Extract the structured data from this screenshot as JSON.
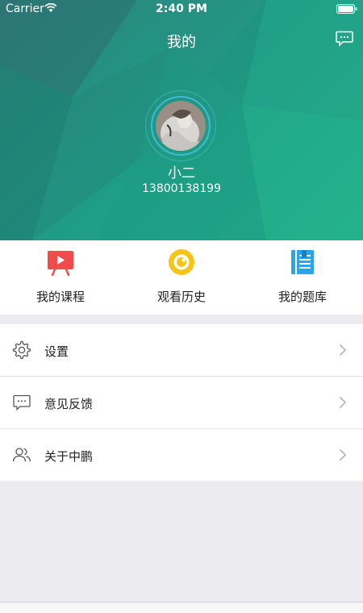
{
  "status_bar": {
    "carrier": "Carrier",
    "time": "2:40 PM"
  },
  "header": {
    "title": "我的",
    "accent_color": "#22b48c"
  },
  "profile": {
    "name": "小二",
    "phone": "13800138199"
  },
  "quick_actions": [
    {
      "label": "我的课程",
      "icon": "video-course-icon",
      "color": "#f04c4c"
    },
    {
      "label": "观看历史",
      "icon": "eye-history-icon",
      "color": "#f5c518"
    },
    {
      "label": "我的题库",
      "icon": "question-bank-icon",
      "color": "#2aa6e8"
    }
  ],
  "menu": [
    {
      "label": "设置",
      "icon": "gear-icon"
    },
    {
      "label": "意见反馈",
      "icon": "feedback-icon"
    },
    {
      "label": "关于中鹏",
      "icon": "users-icon"
    }
  ]
}
